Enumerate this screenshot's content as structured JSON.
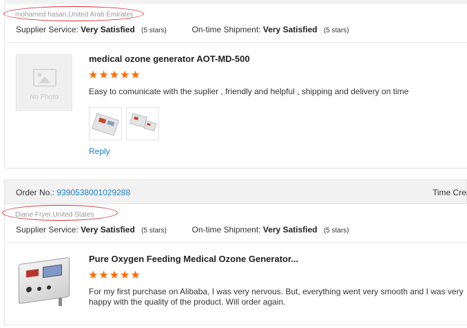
{
  "review1": {
    "reviewer": "mohamed hasan,United Arab Emirates",
    "supplier_service_label": "Supplier Service:",
    "supplier_service_value": "Very Satisfied",
    "supplier_service_stars": "(5 stars)",
    "shipment_label": "On-time Shipment:",
    "shipment_value": "Very Satisfied",
    "shipment_stars": "(5 stars)",
    "product_title": "medical ozone generator AOT-MD-500",
    "stars": "★★★★★",
    "rating": 5,
    "comment": "Easy to comunicate with the suplier , friendly and helpful , shipping and delivery on time",
    "no_photo": "No Photo",
    "reply": "Reply"
  },
  "review2": {
    "order_label": "Order No.:",
    "order_number": "9390538001029288",
    "time_label": "Time Crea",
    "reviewer": "Diane Fryer,United States",
    "supplier_service_label": "Supplier Service:",
    "supplier_service_value": "Very Satisfied",
    "supplier_service_stars": "(5 stars)",
    "shipment_label": "On-time Shipment:",
    "shipment_value": "Very Satisfied",
    "shipment_stars": "(5 stars)",
    "product_title": "Pure Oxygen Feeding Medical Ozone Generator...",
    "stars": "★★★★★",
    "rating": 5,
    "comment_line1": "For my first purchase on Alibaba, I was very nervous.  But, everything went very smooth and I was very",
    "comment_line2": "happy with the quality of the product.  Will order again."
  },
  "colors": {
    "star": "#ff6a00",
    "link": "#1a7fc9",
    "annotation_oval": "#d9272e",
    "header_bg": "#f2f2f2"
  }
}
